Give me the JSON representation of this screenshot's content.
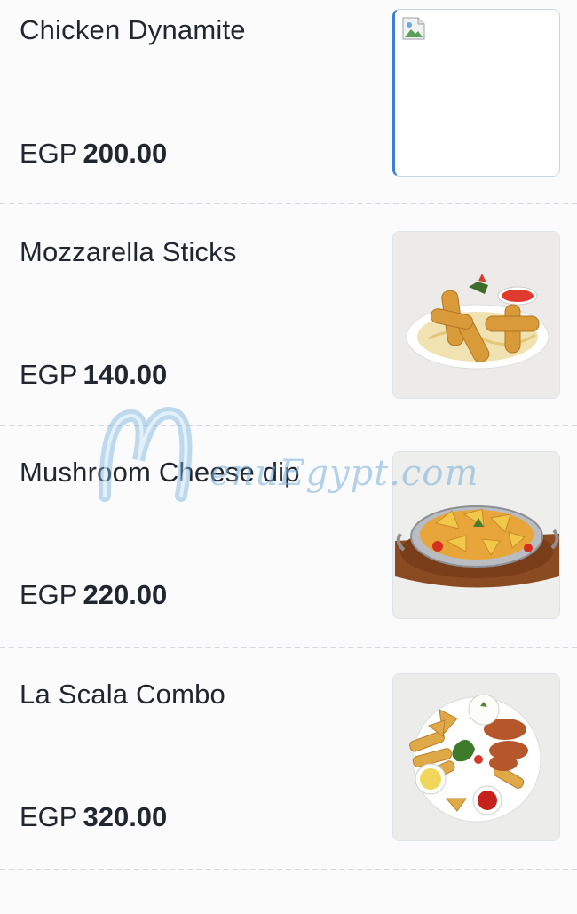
{
  "currency": "EGP",
  "items": [
    {
      "name": "Chicken Dynamite",
      "price": "200.00",
      "image": "broken-image-icon"
    },
    {
      "name": "Mozzarella Sticks",
      "price": "140.00",
      "image": "mozzarella-sticks-photo"
    },
    {
      "name": "Mushroom Cheese dip",
      "price": "220.00",
      "image": "mushroom-cheese-dip-photo"
    },
    {
      "name": "La Scala Combo",
      "price": "320.00",
      "image": "la-scala-combo-photo"
    }
  ],
  "watermark": {
    "text": "enuEgypt.com"
  }
}
